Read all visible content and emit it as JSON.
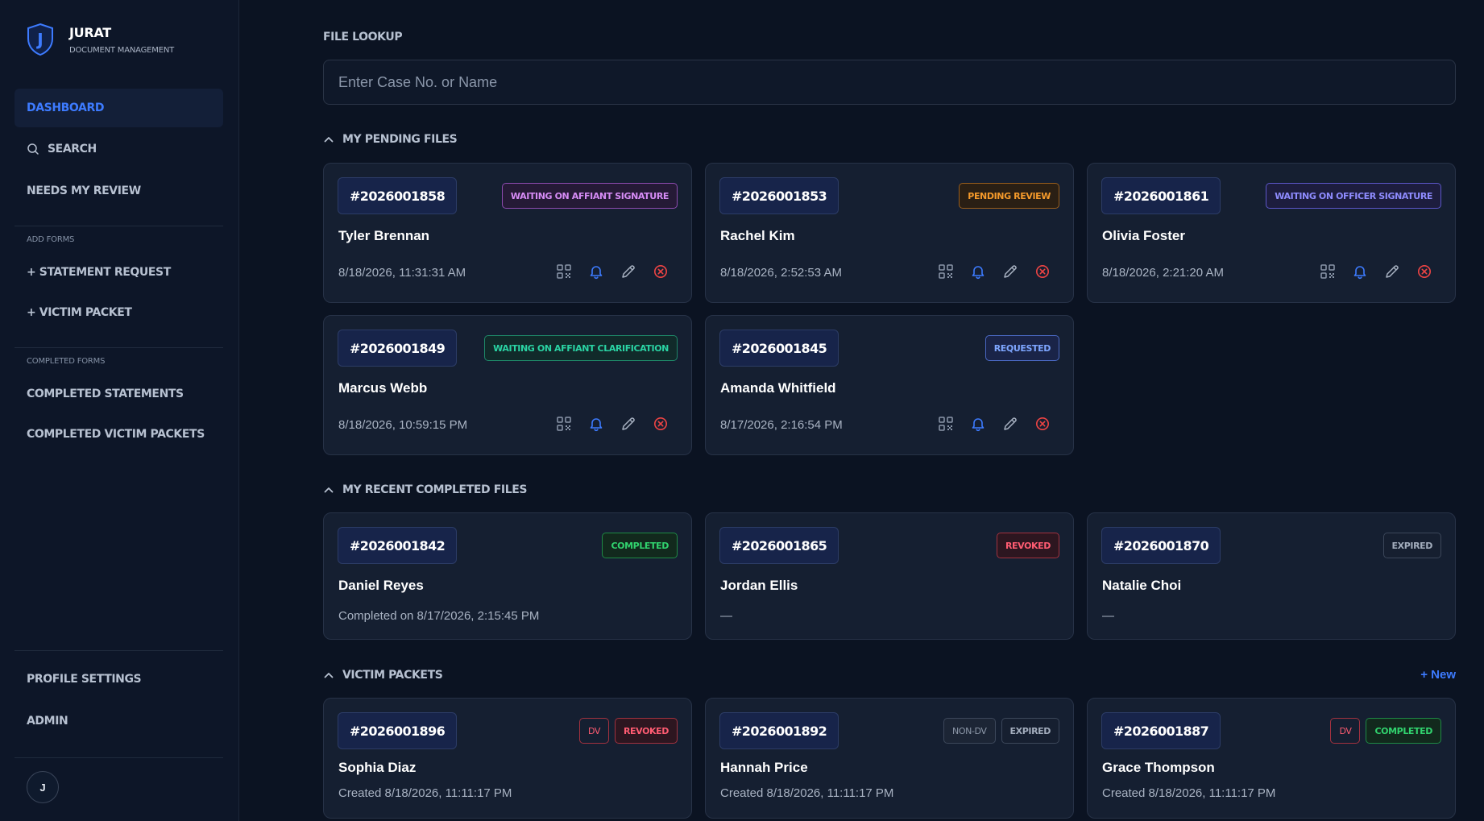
{
  "brand": {
    "logo_letter": "J",
    "title": "JURAT",
    "subtitle": "DOCUMENT MANAGEMENT"
  },
  "sidebar": {
    "dashboard": "DASHBOARD",
    "search": "SEARCH",
    "needs_review": "NEEDS MY REVIEW",
    "add_forms_heading": "ADD FORMS",
    "statement_request": "+ STATEMENT REQUEST",
    "victim_packet": "+ VICTIM PACKET",
    "completed_forms_heading": "COMPLETED FORMS",
    "completed_statements": "COMPLETED STATEMENTS",
    "completed_victim_packets": "COMPLETED VICTIM PACKETS",
    "profile_settings": "PROFILE SETTINGS",
    "admin": "ADMIN",
    "avatar_initial": "J"
  },
  "lookup": {
    "label": "FILE LOOKUP",
    "placeholder": "Enter Case No. or Name",
    "value": ""
  },
  "pending": {
    "heading": "MY PENDING FILES",
    "cards": [
      {
        "case_no": "#2026001858",
        "status": "WAITING ON AFFIANT SIGNATURE",
        "name": "Tyler Brennan",
        "date": "8/18/2026, 11:31:31 AM"
      },
      {
        "case_no": "#2026001853",
        "status": "PENDING REVIEW",
        "name": "Rachel Kim",
        "date": "8/18/2026, 2:52:53 AM"
      },
      {
        "case_no": "#2026001861",
        "status": "WAITING ON OFFICER SIGNATURE",
        "name": "Olivia Foster",
        "date": "8/18/2026, 2:21:20 AM"
      },
      {
        "case_no": "#2026001849",
        "status": "WAITING ON AFFIANT CLARIFICATION",
        "name": "Marcus Webb",
        "date": "8/18/2026, 10:59:15 PM"
      },
      {
        "case_no": "#2026001845",
        "status": "REQUESTED",
        "name": "Amanda Whitfield",
        "date": "8/17/2026, 2:16:54 PM"
      }
    ]
  },
  "completed": {
    "heading": "MY RECENT COMPLETED FILES",
    "cards": [
      {
        "case_no": "#2026001842",
        "status": "COMPLETED",
        "name": "Daniel Reyes",
        "detail": "Completed on 8/17/2026, 2:15:45 PM"
      },
      {
        "case_no": "#2026001865",
        "status": "REVOKED",
        "name": "Jordan Ellis",
        "detail": "—"
      },
      {
        "case_no": "#2026001870",
        "status": "EXPIRED",
        "name": "Natalie Choi",
        "detail": "—"
      }
    ]
  },
  "victim": {
    "heading": "VICTIM PACKETS",
    "new_label": "+ New",
    "cards": [
      {
        "case_no": "#2026001896",
        "type": "DV",
        "status": "REVOKED",
        "name": "Sophia Diaz",
        "detail": "Created 8/18/2026, 11:11:17 PM"
      },
      {
        "case_no": "#2026001892",
        "type": "NON-DV",
        "status": "EXPIRED",
        "name": "Hannah Price",
        "detail": "Created 8/18/2026, 11:11:17 PM"
      },
      {
        "case_no": "#2026001887",
        "type": "DV",
        "status": "COMPLETED",
        "name": "Grace Thompson",
        "detail": "Created 8/18/2026, 11:11:17 PM"
      }
    ]
  },
  "colors": {
    "accent": "#3d7bff",
    "background": "#0b1322",
    "card": "#151f31",
    "danger": "#ff5c72"
  },
  "icons": {
    "qr": "qr-code-icon",
    "bell": "bell-icon",
    "edit": "pencil-icon",
    "cancel": "x-circle-icon",
    "search": "search-icon",
    "chevron": "chevron-up-icon"
  }
}
